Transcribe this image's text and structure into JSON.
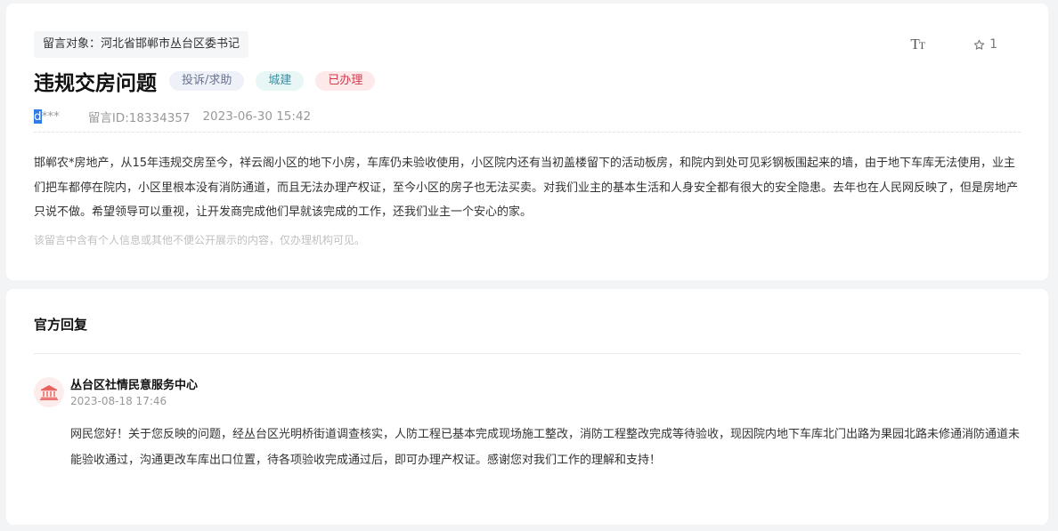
{
  "message": {
    "target": "留言对象：河北省邯郸市丛台区委书记",
    "font_tool_big": "T",
    "font_tool_small": "T",
    "favorite_count": "1",
    "title": "违规交房问题",
    "tags": {
      "type": "投诉/求助",
      "category": "城建",
      "status": "已办理"
    },
    "user_initial": "d",
    "user_mask": "***",
    "message_id": "留言ID:18334357",
    "datetime": "2023-06-30 15:42",
    "content": "邯郸农*房地产，从15年违规交房至今，祥云阁小区的地下小房，车库仍未验收使用，小区院内还有当初盖楼留下的活动板房，和院内到处可见彩钢板围起来的墙，由于地下车库无法使用，业主们把车都停在院内，小区里根本没有消防通道，而且无法办理产权证，至今小区的房子也无法买卖。对我们业主的基本生活和人身安全都有很大的安全隐患。去年也在人民网反映了，但是房地产只说不做。希望领导可以重视，让开发商完成他们早就该完成的工作，还我们业主一个安心的家。",
    "privacy_note": "该留言中含有个人信息或其他不便公开展示的内容，仅办理机构可见。"
  },
  "reply": {
    "section_title": "官方回复",
    "org_name": "丛台区社情民意服务中心",
    "datetime": "2023-08-18 17:46",
    "content": "网民您好！关于您反映的问题，经丛台区光明桥街道调查核实，人防工程已基本完成现场施工整改，消防工程整改完成等待验收，现因院内地下车库北门出路为果园北路未修通消防通道未能验收通过，沟通更改车库出口位置，待各项验收完成通过后，即可办理产权证。感谢您对我们工作的理解和支持！"
  },
  "colors": {
    "status_red": "#d03a4c",
    "category_teal": "#3d8ea0",
    "selection_blue": "#2f7be8"
  },
  "icons": {
    "font_size": "font-size-icon",
    "favorite": "star-outline-icon",
    "organization": "government-building-icon"
  }
}
